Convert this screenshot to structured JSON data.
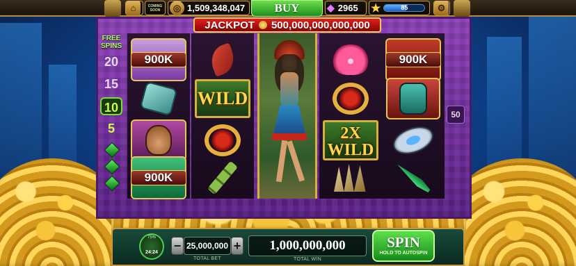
{
  "top_bar": {
    "home_icon": "home-icon",
    "coming_soon_label": "COMING SOON",
    "coin_balance": "1,509,348,047",
    "coin_icon": "coin-stack-icon",
    "buy_label": "BUY",
    "gem_count": "2965",
    "gem_icon": "diamond-icon",
    "level_star_icon": "star-icon",
    "level_value": "85",
    "level_progress": 0.55,
    "settings_icon": "gear-icon"
  },
  "jackpot": {
    "label": "JACKPOT",
    "amount": "500,000,000,000,000"
  },
  "free_spins": {
    "title_line1": "FREE",
    "title_line2": "SPINS",
    "options": [
      "20",
      "15",
      "10",
      "5"
    ],
    "selected": "10"
  },
  "reels": {
    "col1": [
      {
        "type": "value",
        "text": "900K",
        "icon": "jade-mask-tile"
      },
      {
        "type": "icon",
        "icon": "stone-glyph-icon"
      },
      {
        "type": "icon",
        "icon": "tribal-mask-icon"
      },
      {
        "type": "value",
        "text": "900K",
        "icon": "jade-tile"
      }
    ],
    "col2": [
      {
        "type": "icon",
        "icon": "red-leaf-icon"
      },
      {
        "type": "wild",
        "text": "WILD"
      },
      {
        "type": "icon",
        "icon": "gold-ring-icon"
      },
      {
        "type": "icon",
        "icon": "bamboo-icon"
      }
    ],
    "col3": {
      "type": "character",
      "icon": "jungle-dancer-character"
    },
    "col4": [
      {
        "type": "icon",
        "icon": "pink-flower-icon"
      },
      {
        "type": "icon",
        "icon": "gold-ring-icon"
      },
      {
        "type": "wild2x",
        "line1": "2X",
        "line2": "WILD"
      },
      {
        "type": "icon",
        "icon": "claw-icon"
      }
    ],
    "col5": [
      {
        "type": "value",
        "text": "900K",
        "icon": "red-jade-tile"
      },
      {
        "type": "icon",
        "icon": "tiki-mask-icon"
      },
      {
        "type": "icon",
        "icon": "silver-disc-icon"
      },
      {
        "type": "icon",
        "icon": "jade-dagger-icon"
      }
    ],
    "side_value": "50"
  },
  "bottom_bar": {
    "timer_percent": "75%",
    "timer_time": "24:24",
    "minus_label": "−",
    "plus_label": "+",
    "total_bet": "25,000,000",
    "total_bet_label": "TOTAL BET",
    "total_win": "1,000,000,000",
    "total_win_label": "TOTAL WIN",
    "spin_label": "SPIN",
    "spin_sublabel": "HOLD TO AUTOSPIN"
  }
}
